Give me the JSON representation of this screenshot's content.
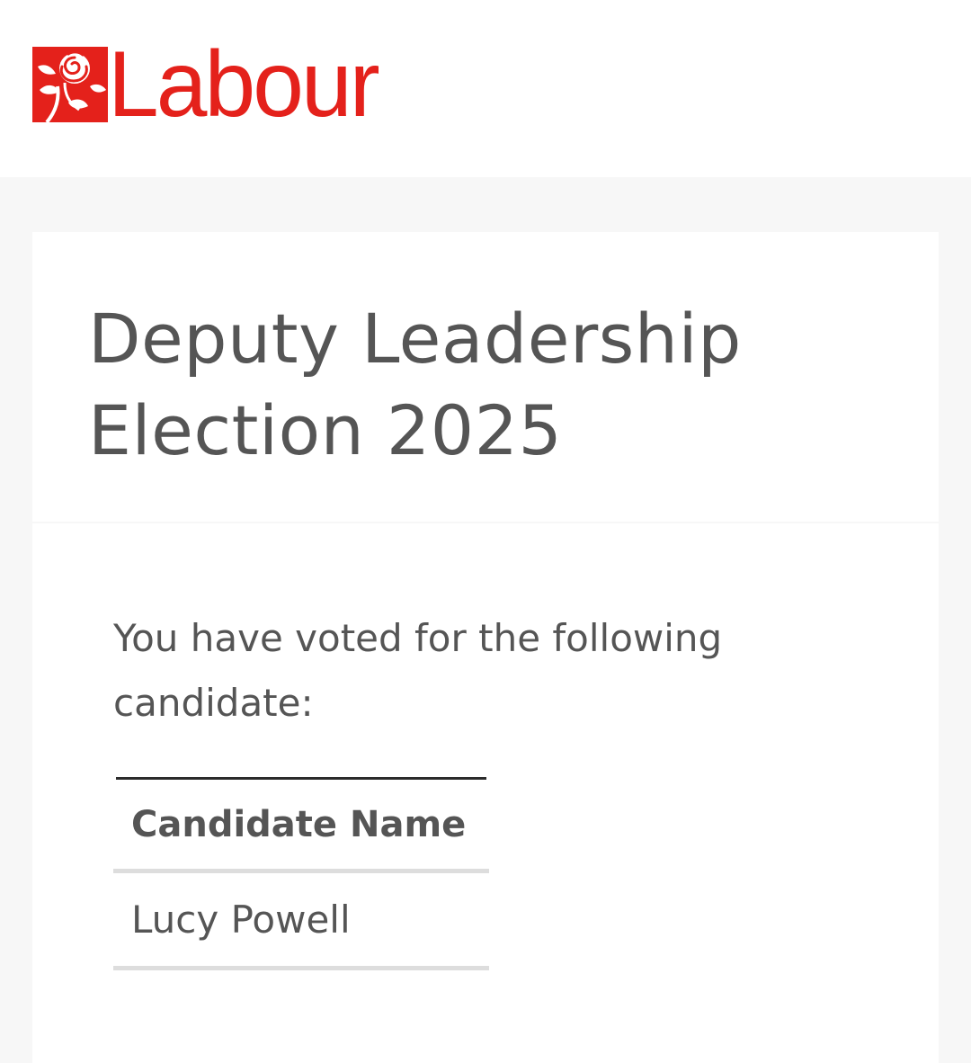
{
  "header": {
    "logo": {
      "text": "Labour",
      "icon": "rose-icon",
      "brand_color": "#e4211b"
    }
  },
  "page": {
    "title": "Deputy Leadership Election 2025"
  },
  "confirmation": {
    "intro": "You have voted for the following candidate:",
    "table": {
      "columns": [
        "Candidate Name"
      ],
      "rows": [
        [
          "Lucy Powell"
        ]
      ]
    }
  }
}
